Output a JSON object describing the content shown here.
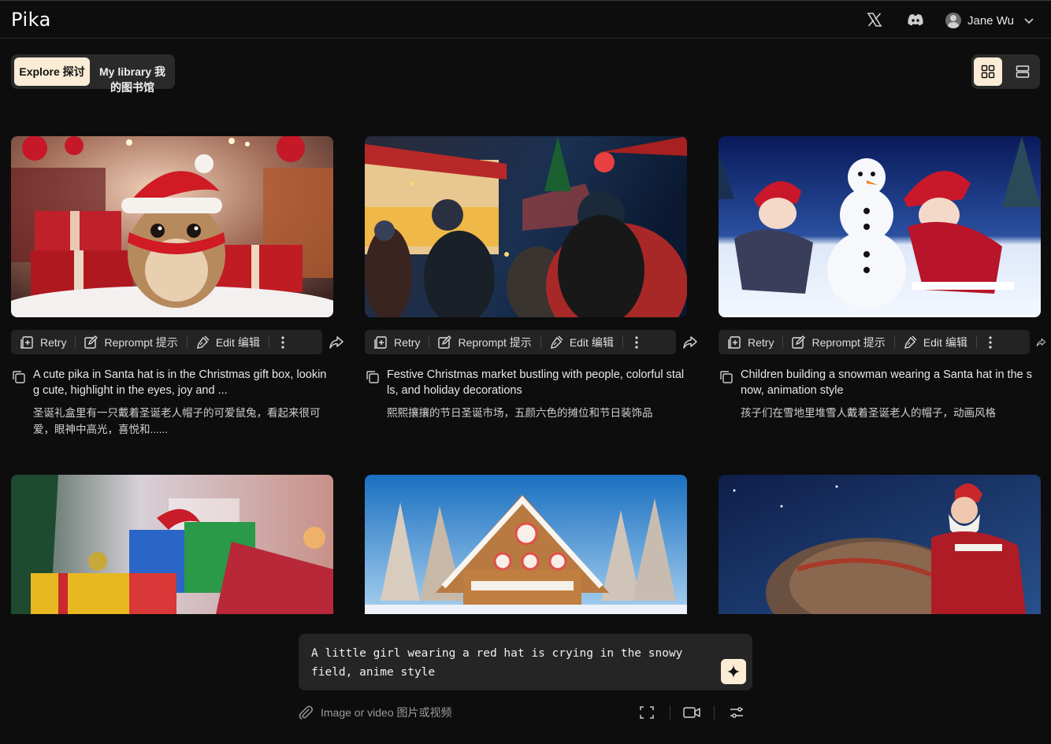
{
  "app": {
    "logo": "Pika"
  },
  "header": {
    "x_icon": "x-logo-icon",
    "discord_icon": "discord-icon",
    "user_name": "Jane Wu"
  },
  "tabs": {
    "explore": "Explore 探讨",
    "library_line1": "My library 我",
    "library_line2": "的图书馆"
  },
  "view_toggle": {
    "selected": "grid"
  },
  "toolbar": {
    "retry": "Retry",
    "reprompt": "Reprompt 提示",
    "edit": "Edit 编辑"
  },
  "cards": [
    {
      "caption_en": "A cute pika in Santa hat is in the Christmas gift box, looking cute, highlight in the eyes, joy and ...",
      "caption_zh": "圣诞礼盒里有一只戴着圣诞老人帽子的可爱鼠兔，看起来很可爱，眼神中高光，喜悦和......"
    },
    {
      "caption_en": "Festive Christmas market bustling with people, colorful stalls, and holiday decorations",
      "caption_zh": "熙熙攘攘的节日圣诞市场，五颜六色的摊位和节日装饰品"
    },
    {
      "caption_en": "Children building a snowman wearing a Santa hat in the snow, animation style",
      "caption_zh": "孩子们在雪地里堆雪人戴着圣诞老人的帽子，动画风格"
    }
  ],
  "prompt": {
    "text": "A little girl wearing a red hat is crying in the snowy field, anime style"
  },
  "bottom": {
    "attach_label": "Image or video 图片或视频"
  },
  "colors": {
    "background": "#0d0d0d",
    "accent": "#fbecd6",
    "panel": "#252525"
  }
}
